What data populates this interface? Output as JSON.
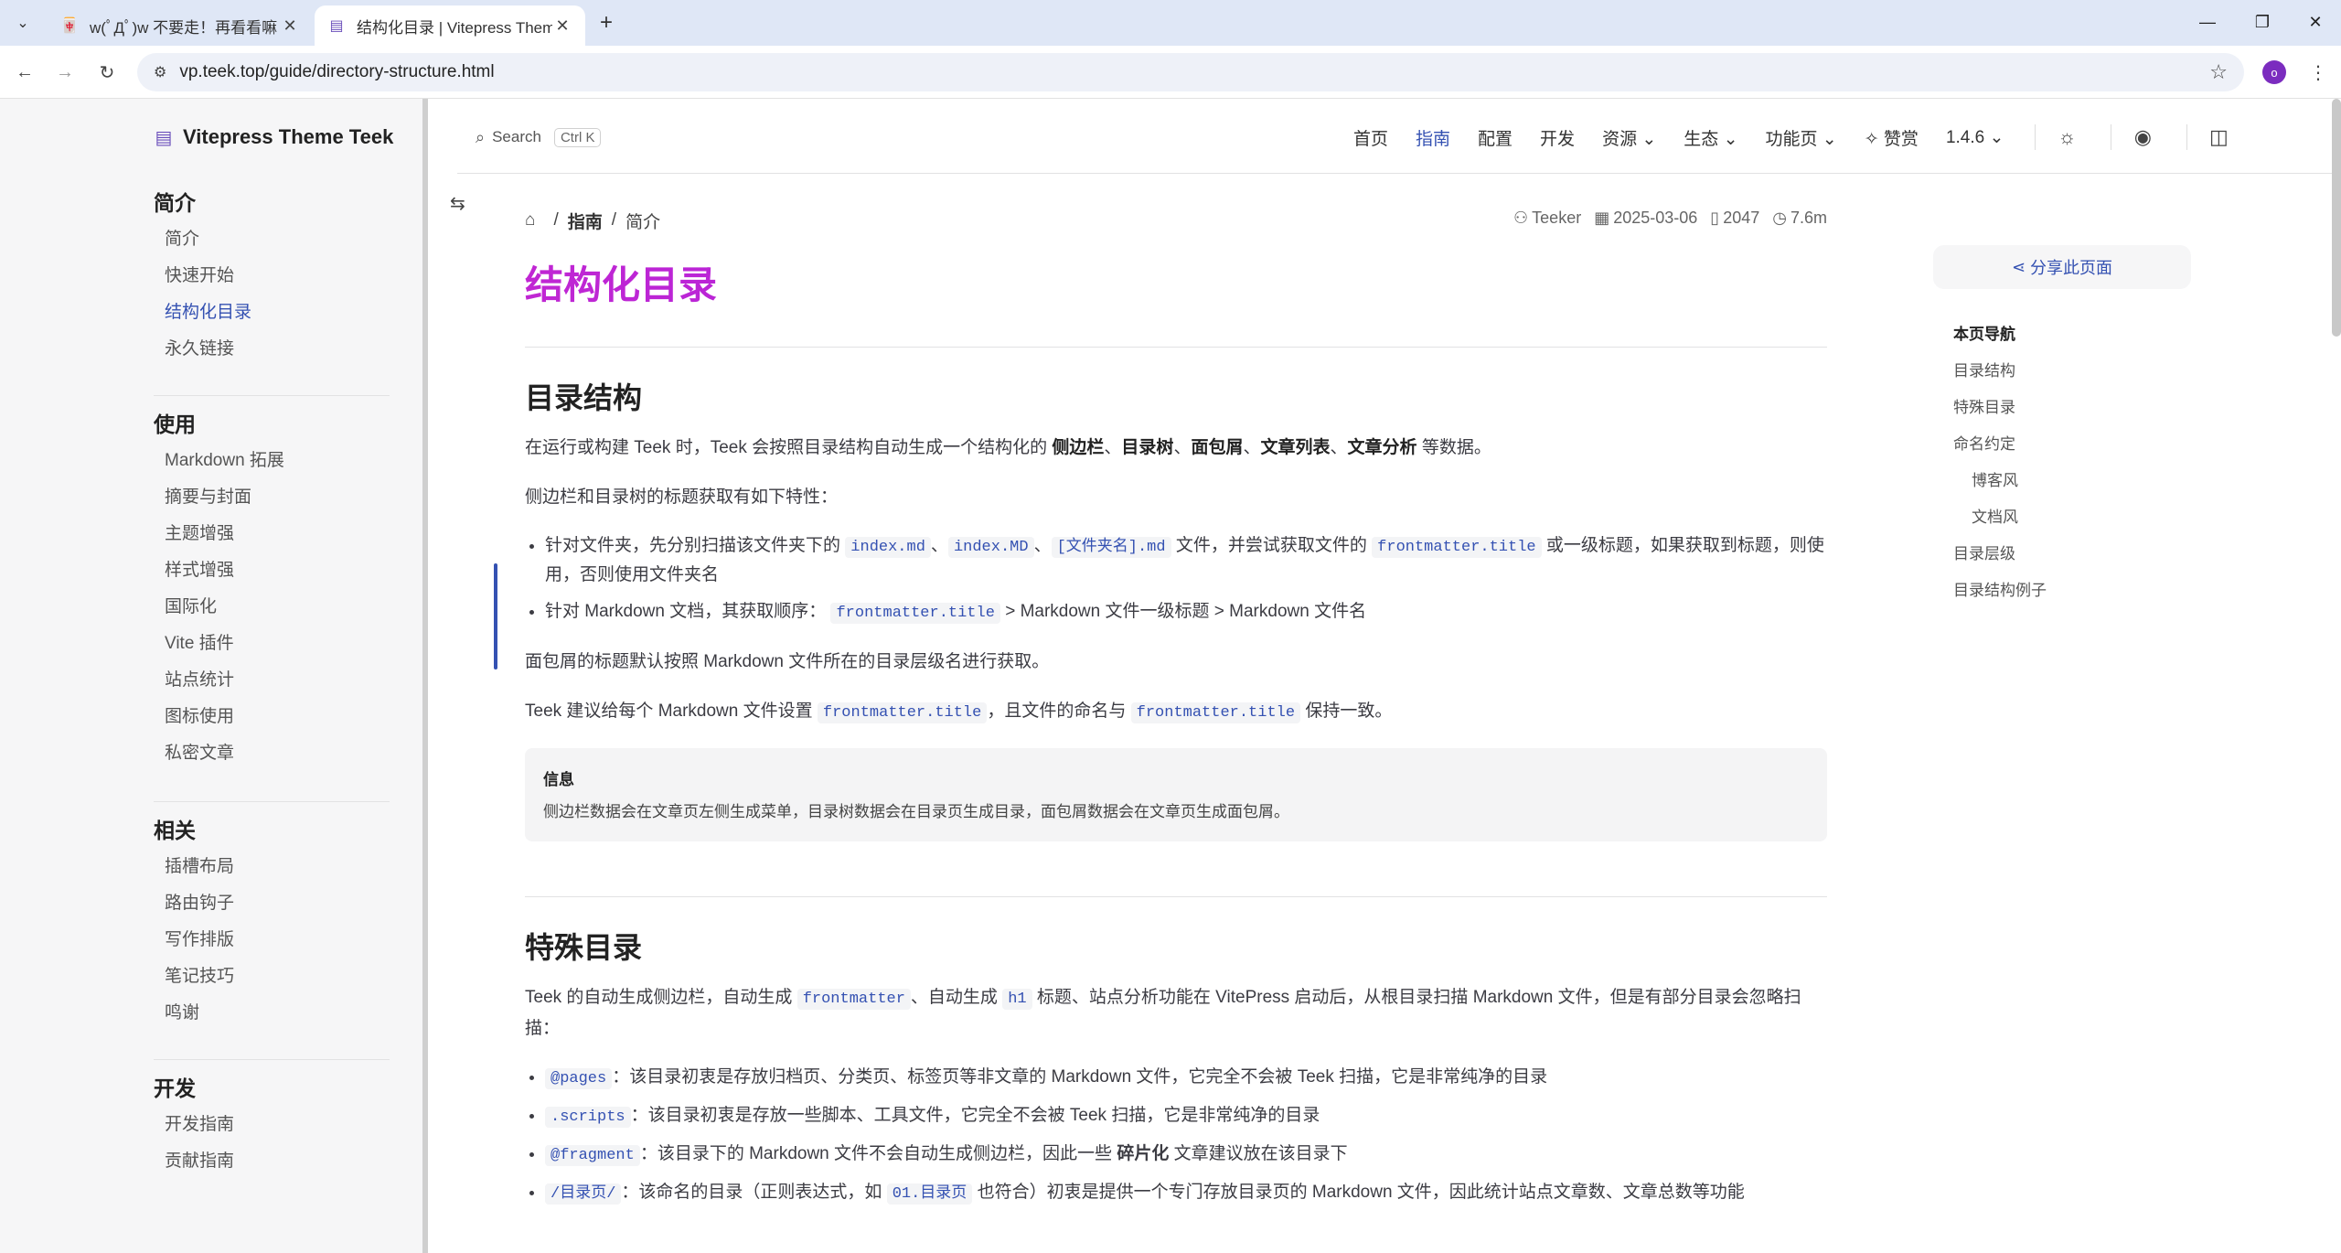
{
  "browser": {
    "tabs": [
      {
        "title": "w(ﾟДﾟ)w 不要走！再看看嘛！",
        "active": false
      },
      {
        "title": "结构化目录 | Vitepress Theme",
        "active": true
      }
    ],
    "url": "vp.teek.top/guide/directory-structure.html",
    "profile_initial": "o"
  },
  "site": {
    "logo_text": "Vitepress Theme Teek",
    "search_label": "Search",
    "search_shortcut": "Ctrl K",
    "nav": [
      "首页",
      "指南",
      "配置",
      "开发",
      "资源",
      "生态",
      "功能页"
    ],
    "nav_active": "指南",
    "donate": "赞赏",
    "version": "1.4.6"
  },
  "sidebar": {
    "groups": [
      {
        "title": "简介",
        "items": [
          "简介",
          "快速开始",
          "结构化目录",
          "永久链接"
        ]
      },
      {
        "title": "使用",
        "items": [
          "Markdown 拓展",
          "摘要与封面",
          "主题增强",
          "样式增强",
          "国际化",
          "Vite 插件",
          "站点统计",
          "图标使用",
          "私密文章"
        ]
      },
      {
        "title": "相关",
        "items": [
          "插槽布局",
          "路由钩子",
          "写作排版",
          "笔记技巧",
          "鸣谢"
        ]
      },
      {
        "title": "开发",
        "items": [
          "开发指南",
          "贡献指南"
        ]
      }
    ],
    "active_item": "结构化目录"
  },
  "doc": {
    "breadcrumb": [
      "指南",
      "简介"
    ],
    "meta": {
      "author": "Teeker",
      "date": "2025-03-06",
      "words": "2047",
      "time": "7.6m"
    },
    "title": "结构化目录",
    "s1": {
      "heading": "目录结构",
      "p1_a": "在运行或构建 Teek 时，Teek 会按照目录结构自动生成一个结构化的",
      "p1_b1": "侧边栏",
      "p1_b2": "目录树",
      "p1_b3": "面包屑",
      "p1_b4": "文章列表",
      "p1_b5": "文章分析",
      "p1_c": "等数据。",
      "p2": "侧边栏和目录树的标题获取有如下特性：",
      "li1_a": "针对文件夹，先分别扫描该文件夹下的",
      "li1_code1": "index.md",
      "li1_code2": "index.MD",
      "li1_code3": "[文件夹名].md",
      "li1_b": "文件，并尝试获取文件的",
      "li1_code4": "frontmatter.title",
      "li1_c": "或一级标题，如果获取到标题，则使用，否则使用文件夹名",
      "li2_a": "针对 Markdown 文档，其获取顺序：",
      "li2_code": "frontmatter.title",
      "li2_b": "> Markdown 文件一级标题 > Markdown 文件名",
      "p3": "面包屑的标题默认按照 Markdown 文件所在的目录层级名进行获取。",
      "p4_a": "Teek 建议给每个 Markdown 文件设置",
      "p4_code1": "frontmatter.title",
      "p4_b": "，且文件的命名与",
      "p4_code2": "frontmatter.title",
      "p4_c": "保持一致。",
      "callout_title": "信息",
      "callout_body": "侧边栏数据会在文章页左侧生成菜单，目录树数据会在目录页生成目录，面包屑数据会在文章页生成面包屑。"
    },
    "s2": {
      "heading": "特殊目录",
      "p1_a": "Teek 的自动生成侧边栏，自动生成",
      "p1_code1": "frontmatter",
      "p1_b": "、自动生成",
      "p1_code2": "h1",
      "p1_c": "标题、站点分析功能在 VitePress 启动后，从根目录扫描 Markdown 文件，但是有部分目录会忽略扫描：",
      "li1_code": "@pages",
      "li1": "：该目录初衷是存放归档页、分类页、标签页等非文章的 Markdown 文件，它完全不会被 Teek 扫描，它是非常纯净的目录",
      "li2_code": ".scripts",
      "li2": "：该目录初衷是存放一些脚本、工具文件，它完全不会被 Teek 扫描，它是非常纯净的目录",
      "li3_code": "@fragment",
      "li3_a": "：该目录下的 Markdown 文件不会自动生成侧边栏，因此一些",
      "li3_b": "碎片化",
      "li3_c": "文章建议放在该目录下",
      "li4_code": "/目录页/",
      "li4_a": "：该命名的目录（正则表达式，如",
      "li4_code2": "01.目录页",
      "li4_b": "也符合）初衷是提供一个专门存放目录页的 Markdown 文件，因此统计站点文章数、文章总数等功能"
    }
  },
  "aside": {
    "share": "分享此页面",
    "toc_title": "本页导航",
    "toc": [
      {
        "label": "目录结构",
        "sub": false
      },
      {
        "label": "特殊目录",
        "sub": false
      },
      {
        "label": "命名约定",
        "sub": false
      },
      {
        "label": "博客风",
        "sub": true
      },
      {
        "label": "文档风",
        "sub": true
      },
      {
        "label": "目录层级",
        "sub": false
      },
      {
        "label": "目录结构例子",
        "sub": false
      }
    ]
  }
}
